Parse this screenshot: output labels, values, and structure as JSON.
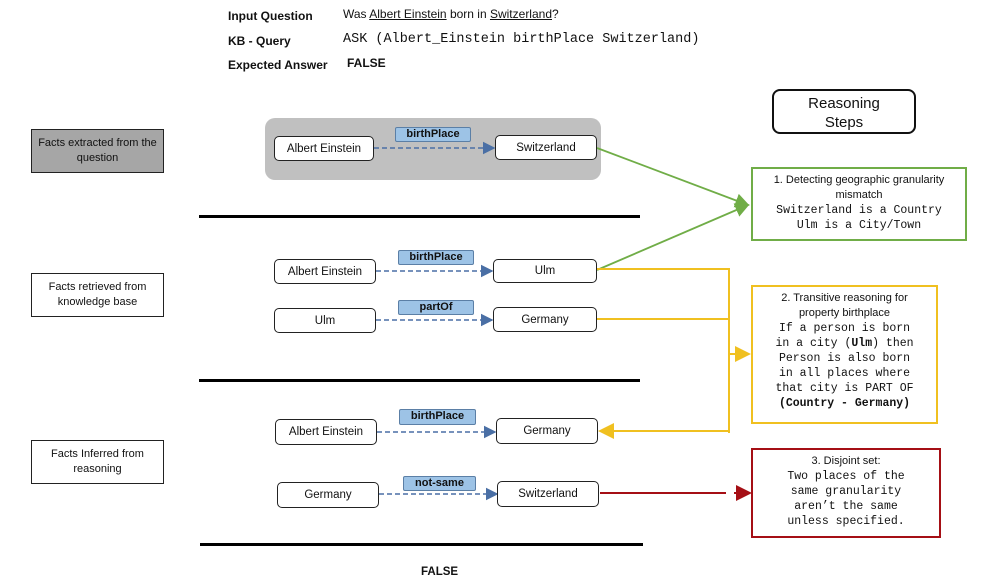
{
  "header": {
    "input_question_label": "Input Question",
    "input_question": {
      "prefix": "Was ",
      "subject": "Albert Einstein",
      "middle": " born in ",
      "object": "Switzerland",
      "suffix": "?"
    },
    "kb_query_label": "KB - Query",
    "kb_query": "ASK (Albert_Einstein birthPlace Switzerland)",
    "expected_answer_label": "Expected Answer",
    "expected_answer": "FALSE"
  },
  "sections": [
    {
      "label": "Facts extracted from the question",
      "triples": [
        {
          "subject": "Albert Einstein",
          "predicate": "birthPlace",
          "object": "Switzerland"
        }
      ]
    },
    {
      "label": "Facts retrieved from knowledge base",
      "triples": [
        {
          "subject": "Albert Einstein",
          "predicate": "birthPlace",
          "object": "Ulm"
        },
        {
          "subject": "Ulm",
          "predicate": "partOf",
          "object": "Germany"
        }
      ]
    },
    {
      "label": "Facts Inferred from reasoning",
      "triples": [
        {
          "subject": "Albert Einstein",
          "predicate": "birthPlace",
          "object": "Germany"
        },
        {
          "subject": "Germany",
          "predicate": "not-same",
          "object": "Switzerland"
        }
      ]
    }
  ],
  "reasoning": {
    "title_line1": "Reasoning",
    "title_line2": "Steps",
    "steps": [
      {
        "title_line1": "1. Detecting geographic granularity",
        "title_line2": "mismatch",
        "body": [
          "Switzerland is a Country",
          "Ulm is a City/Town"
        ],
        "color": "#70ad47"
      },
      {
        "title_line1": "2. Transitive reasoning for",
        "title_line2": "property birthplace",
        "body_line1": "If a person is born",
        "body_line2_pre": "in a city (",
        "body_line2_bold": "Ulm",
        "body_line2_post": ") then",
        "body_line3": "Person is also born",
        "body_line4": "in all places where",
        "body_line5": "that city is PART OF",
        "body_line6": "(Country - Germany)",
        "color": "#f0c020"
      },
      {
        "title_line1": "3. Disjoint set:",
        "body": [
          "Two places of the",
          "same granularity",
          "aren’t the same",
          "unless specified."
        ],
        "color": "#a50f15"
      }
    ]
  },
  "final_answer": "FALSE",
  "colors": {
    "relation_fill": "#9dc3e6",
    "relation_arrow": "#4a6fa5",
    "question_group_bg": "#c0c0c0",
    "section1_box_bg": "#a6a6a6",
    "step1": "#70ad47",
    "step2": "#f0c020",
    "step3": "#a50f15"
  }
}
